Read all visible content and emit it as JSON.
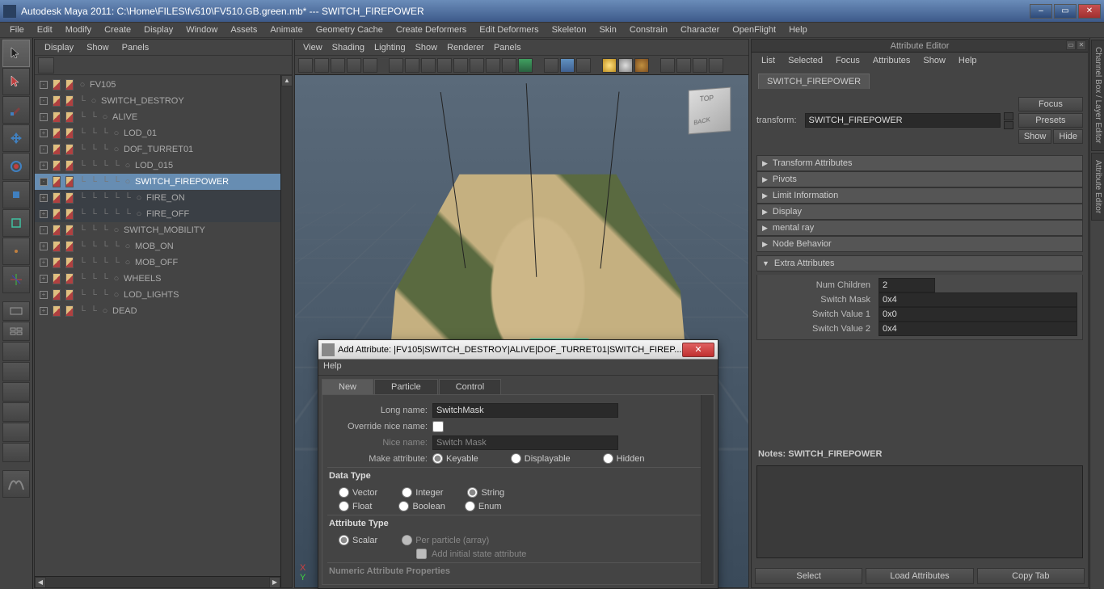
{
  "window": {
    "title": "Autodesk Maya 2011: C:\\Home\\FILES\\fv510\\FV510.GB.green.mb*  ---    SWITCH_FIREPOWER"
  },
  "main_menu": [
    "File",
    "Edit",
    "Modify",
    "Create",
    "Display",
    "Window",
    "Assets",
    "Animate",
    "Geometry Cache",
    "Create Deformers",
    "Edit Deformers",
    "Skeleton",
    "Skin",
    "Constrain",
    "Character",
    "OpenFlight",
    "Help"
  ],
  "outliner_menu": [
    "Display",
    "Show",
    "Panels"
  ],
  "hierarchy": [
    {
      "depth": 0,
      "label": "FV105",
      "exp": "-",
      "sel": false
    },
    {
      "depth": 1,
      "label": "SWITCH_DESTROY",
      "exp": "-",
      "sel": false
    },
    {
      "depth": 2,
      "label": "ALIVE",
      "exp": "-",
      "sel": false
    },
    {
      "depth": 3,
      "label": "LOD_01",
      "exp": "+",
      "sel": false
    },
    {
      "depth": 3,
      "label": "DOF_TURRET01",
      "exp": "-",
      "sel": false
    },
    {
      "depth": 4,
      "label": "LOD_015",
      "exp": "+",
      "sel": false
    },
    {
      "depth": 4,
      "label": "SWITCH_FIREPOWER",
      "exp": "-",
      "sel": true
    },
    {
      "depth": 5,
      "label": "FIRE_ON",
      "exp": "+",
      "sel": false,
      "light": true
    },
    {
      "depth": 5,
      "label": "FIRE_OFF",
      "exp": "+",
      "sel": false,
      "light": true
    },
    {
      "depth": 3,
      "label": "SWITCH_MOBILITY",
      "exp": "-",
      "sel": false
    },
    {
      "depth": 4,
      "label": "MOB_ON",
      "exp": "+",
      "sel": false
    },
    {
      "depth": 4,
      "label": "MOB_OFF",
      "exp": "+",
      "sel": false
    },
    {
      "depth": 3,
      "label": "WHEELS",
      "exp": "+",
      "sel": false
    },
    {
      "depth": 3,
      "label": "LOD_LIGHTS",
      "exp": "+",
      "sel": false
    },
    {
      "depth": 2,
      "label": "DEAD",
      "exp": "+",
      "sel": false
    }
  ],
  "vp_menu": [
    "View",
    "Shading",
    "Lighting",
    "Show",
    "Renderer",
    "Panels"
  ],
  "attr": {
    "title": "Attribute Editor",
    "menu": [
      "List",
      "Selected",
      "Focus",
      "Attributes",
      "Show",
      "Help"
    ],
    "tab": "SWITCH_FIREPOWER",
    "transform_label": "transform:",
    "transform_value": "SWITCH_FIREPOWER",
    "btn_focus": "Focus",
    "btn_presets": "Presets",
    "btn_show": "Show",
    "btn_hide": "Hide",
    "sections": [
      "Transform Attributes",
      "Pivots",
      "Limit Information",
      "Display",
      "mental ray",
      "Node Behavior"
    ],
    "extra_title": "Extra Attributes",
    "extra": {
      "numchildren": "2",
      "switchmask": "0x4",
      "switchvalue1": "0x0",
      "switchvalue2": "0x4"
    },
    "extra_labels": {
      "numchildren": "Num Children",
      "switchmask": "Switch Mask",
      "switchvalue1": "Switch Value 1",
      "switchvalue2": "Switch Value 2"
    },
    "notes_label": "Notes: SWITCH_FIREPOWER",
    "footer": [
      "Select",
      "Load Attributes",
      "Copy Tab"
    ]
  },
  "right_tabs": [
    "Channel Box / Layer Editor",
    "Attribute Editor"
  ],
  "dialog": {
    "title": "Add Attribute: |FV105|SWITCH_DESTROY|ALIVE|DOF_TURRET01|SWITCH_FIREP...",
    "menu": "Help",
    "tabs": [
      "New",
      "Particle",
      "Control"
    ],
    "long_name_label": "Long name:",
    "long_name": "SwitchMask",
    "override_label": "Override nice name:",
    "nice_name_label": "Nice name:",
    "nice_name_ph": "Switch Mask",
    "make_attr_label": "Make attribute:",
    "make_attr_opts": [
      "Keyable",
      "Displayable",
      "Hidden"
    ],
    "data_type_header": "Data Type",
    "data_types": [
      "Vector",
      "Integer",
      "String",
      "Float",
      "Boolean",
      "Enum"
    ],
    "attr_type_header": "Attribute Type",
    "attr_type_opts": [
      "Scalar",
      "Per particle (array)"
    ],
    "add_initial": "Add initial state attribute",
    "numeric_header": "Numeric Attribute Properties"
  }
}
